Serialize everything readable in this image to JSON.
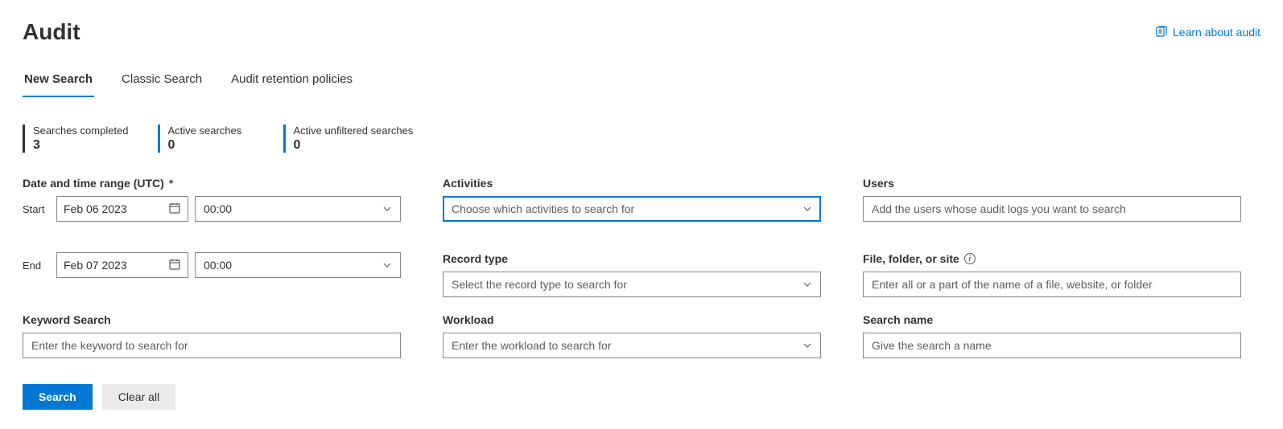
{
  "header": {
    "title": "Audit",
    "learn_link": "Learn about audit"
  },
  "tabs": [
    {
      "label": "New Search",
      "active": true
    },
    {
      "label": "Classic Search",
      "active": false
    },
    {
      "label": "Audit retention policies",
      "active": false
    }
  ],
  "stats": {
    "completed": {
      "label": "Searches completed",
      "value": "3"
    },
    "active": {
      "label": "Active searches",
      "value": "0"
    },
    "unfiltered": {
      "label": "Active unfiltered searches",
      "value": "0"
    }
  },
  "form": {
    "date_range": {
      "label": "Date and time range (UTC)",
      "start": {
        "sub": "Start",
        "date": "Feb 06 2023",
        "time": "00:00"
      },
      "end": {
        "sub": "End",
        "date": "Feb 07 2023",
        "time": "00:00"
      }
    },
    "keyword": {
      "label": "Keyword Search",
      "placeholder": "Enter the keyword to search for"
    },
    "activities": {
      "label": "Activities",
      "placeholder": "Choose which activities to search for"
    },
    "record_type": {
      "label": "Record type",
      "placeholder": "Select the record type to search for"
    },
    "workload": {
      "label": "Workload",
      "placeholder": "Enter the workload to search for"
    },
    "users": {
      "label": "Users",
      "placeholder": "Add the users whose audit logs you want to search"
    },
    "file": {
      "label": "File, folder, or site",
      "placeholder": "Enter all or a part of the name of a file, website, or folder"
    },
    "search_name": {
      "label": "Search name",
      "placeholder": "Give the search a name"
    }
  },
  "buttons": {
    "search": "Search",
    "clear": "Clear all"
  }
}
